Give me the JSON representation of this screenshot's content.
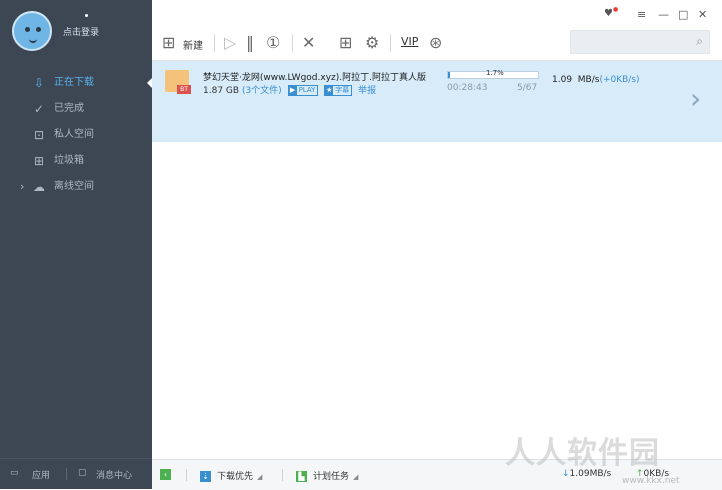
{
  "profile": {
    "login_label": "点击登录"
  },
  "nav": [
    {
      "label": "正在下载",
      "icon": "download-icon",
      "active": true
    },
    {
      "label": "已完成",
      "icon": "check-circle-icon",
      "active": false
    },
    {
      "label": "私人空间",
      "icon": "lock-icon",
      "active": false
    },
    {
      "label": "垃圾箱",
      "icon": "trash-icon",
      "active": false
    },
    {
      "label": "离线空间",
      "icon": "cloud-download-icon",
      "active": false
    }
  ],
  "sidebar_footer": {
    "apps_label": "应用",
    "messages_label": "消息中心"
  },
  "toolbar": {
    "new_label": "新建",
    "vip_label": "VIP",
    "search_placeholder": ""
  },
  "task": {
    "name": "梦幻天堂·龙网(www.LWgod.xyz).阿拉丁.阿拉丁真人版",
    "size": "1.87 GB",
    "files": "(3个文件)",
    "play_tag": "PLAY",
    "subtitle_tag": "字幕",
    "report_label": "举报",
    "progress_text": "1.7%",
    "progress_fraction": 0.017,
    "elapsed": "00:28:43",
    "count": "5/67",
    "speed": "1.09",
    "speed_unit": "MB/s",
    "speed_boost": "(+0KB/s)",
    "file_badge": "BT"
  },
  "statusbar": {
    "priority_label": "下载优先",
    "schedule_label": "计划任务",
    "down_speed": "1.09MB/s",
    "up_speed": "0KB/s"
  },
  "watermark": {
    "text": "人人软件园",
    "url": "www.kkx.net"
  },
  "colors": {
    "sidebar": "#3c4753",
    "accent": "#3a8fd1",
    "row_selected": "#d7ebf9"
  }
}
